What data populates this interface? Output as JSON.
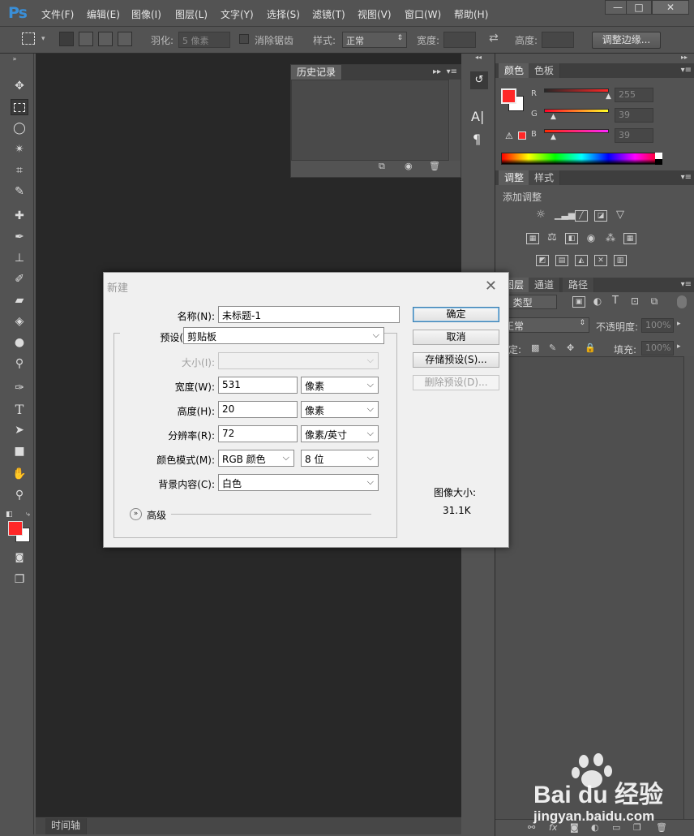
{
  "app": {
    "logo": "Ps"
  },
  "menu": [
    "文件(F)",
    "编辑(E)",
    "图像(I)",
    "图层(L)",
    "文字(Y)",
    "选择(S)",
    "滤镜(T)",
    "视图(V)",
    "窗口(W)",
    "帮助(H)"
  ],
  "window_controls": {
    "minimize": "—",
    "restore": "□",
    "close": "✕"
  },
  "options": {
    "feather_label": "羽化:",
    "feather_value": "5 像素",
    "antialias_label": "消除锯齿",
    "style_label": "样式:",
    "style_value": "正常",
    "width_label": "宽度:",
    "height_label": "高度:",
    "refine_edge": "调整边缘..."
  },
  "history_panel": {
    "title": "历史记录"
  },
  "color_panel": {
    "tabs": [
      "颜色",
      "色板"
    ],
    "r_label": "R",
    "g_label": "G",
    "b_label": "B",
    "r_value": "255",
    "g_value": "39",
    "b_value": "39",
    "fg_color": "#ff2727",
    "bg_color": "#ffffff"
  },
  "adjust_panel": {
    "tabs": [
      "调整",
      "样式"
    ],
    "heading": "添加调整"
  },
  "layers_panel": {
    "tabs": [
      "图层",
      "通道",
      "路径"
    ],
    "filter_label": "类型",
    "blend_mode": "正常",
    "opacity_label": "不透明度:",
    "opacity_value": "100%",
    "lock_label": "锁定:",
    "fill_label": "填充:",
    "fill_value": "100%"
  },
  "timeline": {
    "label": "时间轴"
  },
  "dialog": {
    "title": "新建",
    "close": "✕",
    "name_label": "名称(N):",
    "name_value": "未标题-1",
    "preset_label": "预设(P):",
    "preset_value": "剪贴板",
    "size_label": "大小(I):",
    "width_label": "宽度(W):",
    "width_value": "531",
    "width_unit": "像素",
    "height_label": "高度(H):",
    "height_value": "20",
    "height_unit": "像素",
    "resolution_label": "分辨率(R):",
    "resolution_value": "72",
    "resolution_unit": "像素/英寸",
    "color_mode_label": "颜色模式(M):",
    "color_mode_value": "RGB 颜色",
    "bit_depth_value": "8 位",
    "background_label": "背景内容(C):",
    "background_value": "白色",
    "advanced_label": "高级",
    "ok": "确定",
    "cancel": "取消",
    "save_preset": "存储预设(S)...",
    "delete_preset": "删除预设(D)...",
    "image_size_label": "图像大小:",
    "image_size_value": "31.1K"
  },
  "watermark": {
    "brand": "Bai du 经验",
    "url": "jingyan.baidu.com"
  }
}
